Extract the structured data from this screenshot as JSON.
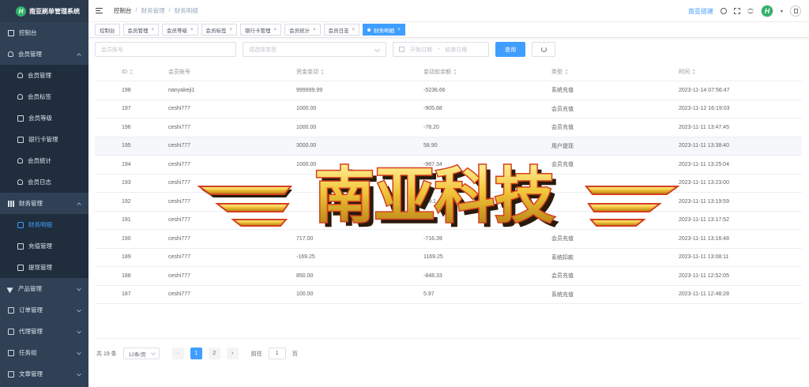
{
  "app": {
    "title": "南亚刷单管理系统",
    "logo_letter": "H"
  },
  "sidebar": {
    "items": [
      {
        "label": "控制台",
        "icon": "home-icon"
      },
      {
        "label": "会员管理",
        "icon": "user-icon",
        "expanded": true
      },
      {
        "label": "会员管理",
        "icon": "user-icon"
      },
      {
        "label": "会员标签",
        "icon": "user-icon"
      },
      {
        "label": "会员等级",
        "icon": "idcard-icon"
      },
      {
        "label": "银行卡管理",
        "icon": "card-icon"
      },
      {
        "label": "会员统计",
        "icon": "user-icon"
      },
      {
        "label": "会员日志",
        "icon": "user-icon"
      },
      {
        "label": "财务管理",
        "icon": "chart-icon",
        "expanded": true
      },
      {
        "label": "财务明细",
        "icon": "detail-icon",
        "active": true
      },
      {
        "label": "充值管理",
        "icon": "box-icon"
      },
      {
        "label": "提现管理",
        "icon": "box-icon"
      },
      {
        "label": "产品管理",
        "icon": "send-icon"
      },
      {
        "label": "订单管理",
        "icon": "order-icon"
      },
      {
        "label": "代理管理",
        "icon": "agent-icon"
      },
      {
        "label": "任务组",
        "icon": "task-icon"
      },
      {
        "label": "文章管理",
        "icon": "doc-icon"
      }
    ]
  },
  "header": {
    "breadcrumb": [
      "控制台",
      "财务管理",
      "财务明细"
    ],
    "site_link": "南亚搭建",
    "avatar_letter": "H"
  },
  "tags": [
    {
      "label": "控制台",
      "closable": false
    },
    {
      "label": "会员管理",
      "closable": true
    },
    {
      "label": "会员等级",
      "closable": true
    },
    {
      "label": "会员标签",
      "closable": true
    },
    {
      "label": "银行卡管理",
      "closable": true
    },
    {
      "label": "会员统计",
      "closable": true
    },
    {
      "label": "会员日志",
      "closable": true
    },
    {
      "label": "财务明细",
      "closable": true,
      "active": true
    }
  ],
  "filters": {
    "account_placeholder": "会员账号",
    "type_placeholder": "请选择类型",
    "start_date_placeholder": "开始日期",
    "date_sep": "-",
    "end_date_placeholder": "结束日期",
    "search_label": "查询"
  },
  "table": {
    "columns": [
      "ID",
      "会员账号",
      "资金变动",
      "变动前余额",
      "类型",
      "时间"
    ],
    "rows": [
      [
        "198",
        "nanyakeji1",
        "999999.99",
        "-5236.66",
        "系统充值",
        "2023-11-14 07:56:47"
      ],
      [
        "197",
        "ceshi777",
        "1000.00",
        "-905.68",
        "会员充值",
        "2023-11-12 16:19:03"
      ],
      [
        "196",
        "ceshi777",
        "1000.00",
        "-78.20",
        "会员充值",
        "2023-11-11 13:47:45"
      ],
      [
        "195",
        "ceshi777",
        "3000.00",
        "58.90",
        "用户提现",
        "2023-11-11 13:38:40"
      ],
      [
        "194",
        "ceshi777",
        "1000.00",
        "-987.34",
        "会员充值",
        "2023-11-11 13:25:04"
      ],
      [
        "193",
        "ceshi777",
        "",
        "",
        "",
        "2023-11-11 13:23:00"
      ],
      [
        "192",
        "ceshi777",
        "",
        "-39.1",
        "",
        "2023-11-11 13:19:59"
      ],
      [
        "191",
        "ceshi777",
        "",
        "",
        "",
        "2023-11-11 13:17:52"
      ],
      [
        "190",
        "ceshi777",
        "717.00",
        "-716.39",
        "会员充值",
        "2023-11-11 13:16:48"
      ],
      [
        "189",
        "ceshi777",
        "-169.25",
        "1169.25",
        "系统扣款",
        "2023-11-11 13:08:11"
      ],
      [
        "188",
        "ceshi777",
        "850.00",
        "-848.33",
        "会员充值",
        "2023-11-11 12:52:05"
      ],
      [
        "187",
        "ceshi777",
        "100.00",
        "5.97",
        "系统充值",
        "2023-11-11 12:48:28"
      ]
    ],
    "highlighted_row": 3
  },
  "pagination": {
    "total_label": "共 19 条",
    "page_size": "12条/页",
    "prev": "‹",
    "next": "›",
    "pages": [
      "1",
      "2"
    ],
    "current": "1",
    "goto_prefix": "前往",
    "goto_value": "1",
    "goto_suffix": "页"
  },
  "watermark": {
    "text": "南亚科技"
  },
  "colors": {
    "sidebar_bg": "#304156",
    "accent": "#409eff",
    "watermark_gold": "#e8b92c",
    "watermark_red": "#d4401e"
  }
}
